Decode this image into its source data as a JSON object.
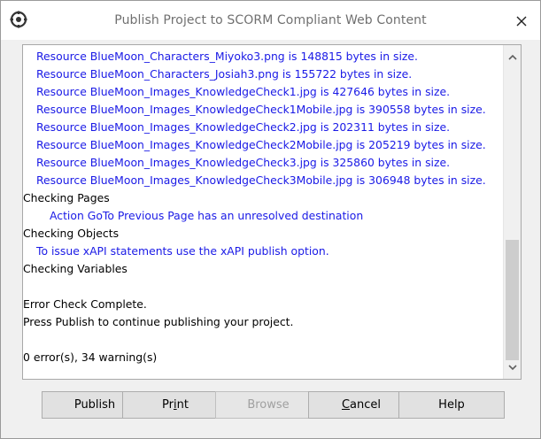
{
  "window": {
    "title": "Publish Project to SCORM Compliant Web Content"
  },
  "log": {
    "lines": [
      {
        "text": "Resource BlueMoon_Characters_Miyoko3.png is 148815 bytes in size.",
        "color": "blue",
        "indent": 1
      },
      {
        "text": "Resource BlueMoon_Characters_Josiah3.png is 155722 bytes in size.",
        "color": "blue",
        "indent": 1
      },
      {
        "text": "Resource BlueMoon_Images_KnowledgeCheck1.jpg is 427646 bytes in size.",
        "color": "blue",
        "indent": 1
      },
      {
        "text": "Resource BlueMoon_Images_KnowledgeCheck1Mobile.jpg is 390558 bytes in size.",
        "color": "blue",
        "indent": 1
      },
      {
        "text": "Resource BlueMoon_Images_KnowledgeCheck2.jpg is 202311 bytes in size.",
        "color": "blue",
        "indent": 1
      },
      {
        "text": "Resource BlueMoon_Images_KnowledgeCheck2Mobile.jpg is 205219 bytes in size.",
        "color": "blue",
        "indent": 1
      },
      {
        "text": "Resource BlueMoon_Images_KnowledgeCheck3.jpg is 325860 bytes in size.",
        "color": "blue",
        "indent": 1
      },
      {
        "text": "Resource BlueMoon_Images_KnowledgeCheck3Mobile.jpg is 306948 bytes in size.",
        "color": "blue",
        "indent": 1
      },
      {
        "text": "Checking Pages",
        "color": "black",
        "indent": 0
      },
      {
        "text": "Action GoTo Previous Page has an unresolved destination",
        "color": "blue",
        "indent": 2
      },
      {
        "text": "Checking Objects",
        "color": "black",
        "indent": 0
      },
      {
        "text": "To issue xAPI statements use the xAPI publish option.",
        "color": "blue",
        "indent": 1
      },
      {
        "text": "Checking Variables",
        "color": "black",
        "indent": 0
      },
      {
        "text": "",
        "color": "black",
        "indent": 0
      },
      {
        "text": "Error Check Complete.",
        "color": "black",
        "indent": 0
      },
      {
        "text": "Press Publish to continue publishing your project.",
        "color": "black",
        "indent": 0
      },
      {
        "text": "",
        "color": "black",
        "indent": 0
      },
      {
        "text": "0 error(s), 34 warning(s)",
        "color": "black",
        "indent": 0
      }
    ]
  },
  "buttons": {
    "publish": {
      "label": "Publish",
      "enabled": true
    },
    "print": {
      "pre": "Pr",
      "accel": "i",
      "post": "nt",
      "enabled": true
    },
    "browse": {
      "label": "Browse",
      "enabled": false
    },
    "cancel": {
      "accel": "C",
      "post": "ancel",
      "enabled": true
    },
    "help": {
      "label": "Help",
      "enabled": true
    }
  },
  "icons": {
    "app": "gear-icon",
    "close": "close-icon",
    "scroll_up": "chevron-up-icon",
    "scroll_down": "chevron-down-icon"
  },
  "colors": {
    "info_text": "#1a1ae6",
    "status_text": "#000000",
    "disabled_text": "#a0a0a0"
  }
}
